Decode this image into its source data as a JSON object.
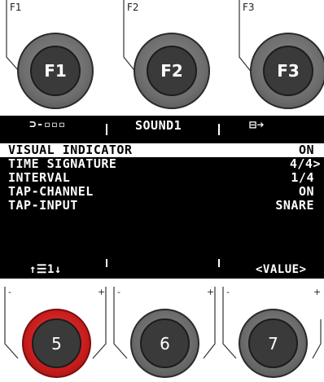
{
  "function_knobs": [
    {
      "tag": "F1",
      "label": "F1"
    },
    {
      "tag": "F2",
      "label": "F2"
    },
    {
      "tag": "F3",
      "label": "F3"
    }
  ],
  "display": {
    "header": {
      "left": "⊃-▫▫▫",
      "center": "SOUND1",
      "right": "⊟➔"
    },
    "rows": [
      {
        "key": "VISUAL INDICATOR",
        "value": "ON",
        "selected": true
      },
      {
        "key": "TIME SIGNATURE",
        "value": "4/4>",
        "selected": false
      },
      {
        "key": "INTERVAL",
        "value": "1/4",
        "selected": false
      },
      {
        "key": "TAP-CHANNEL",
        "value": "ON",
        "selected": false
      },
      {
        "key": "TAP-INPUT",
        "value": "SNARE",
        "selected": false
      }
    ],
    "footer": {
      "left": "↑☰1↓",
      "right": "<VALUE>"
    }
  },
  "encoders": [
    {
      "label": "5",
      "minus": "-",
      "plus": "+",
      "active": true
    },
    {
      "label": "6",
      "minus": "-",
      "plus": "+",
      "active": false
    },
    {
      "label": "7",
      "minus": "-",
      "plus": "+",
      "active": false
    }
  ],
  "colors": {
    "active_ring": "#d42020",
    "screen_bg": "#000000",
    "screen_fg": "#ffffff"
  }
}
